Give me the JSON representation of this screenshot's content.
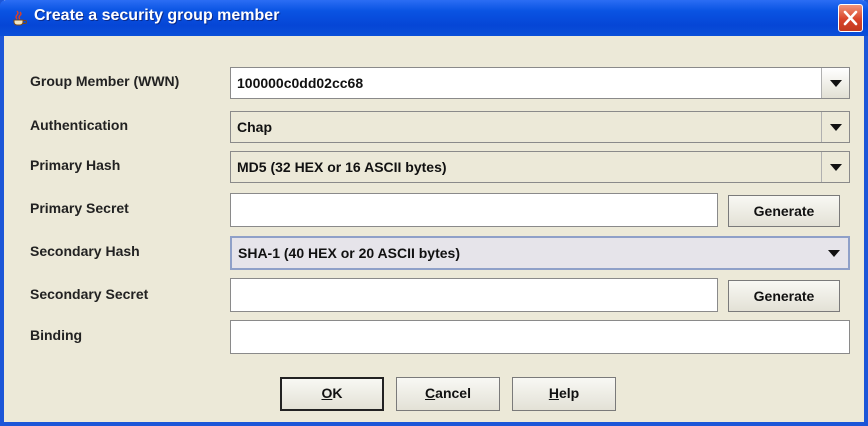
{
  "window": {
    "title": "Create a security group member",
    "close_label": "✕"
  },
  "form": {
    "group_member": {
      "label": "Group Member (WWN)",
      "value": "100000c0dd02cc68"
    },
    "authentication": {
      "label": "Authentication",
      "value": "Chap"
    },
    "primary_hash": {
      "label": "Primary Hash",
      "value": "MD5 (32 HEX or 16 ASCII bytes)"
    },
    "primary_secret": {
      "label": "Primary Secret",
      "value": "",
      "button": "Generate"
    },
    "secondary_hash": {
      "label": "Secondary Hash",
      "value": "SHA-1 (40 HEX or 20 ASCII bytes)"
    },
    "secondary_secret": {
      "label": "Secondary Secret",
      "value": "",
      "button": "Generate"
    },
    "binding": {
      "label": "Binding",
      "value": ""
    }
  },
  "buttons": {
    "ok_mnemonic": "O",
    "ok_rest": "K",
    "cancel_mnemonic": "C",
    "cancel_rest": "ancel",
    "help_mnemonic": "H",
    "help_rest": "elp"
  }
}
